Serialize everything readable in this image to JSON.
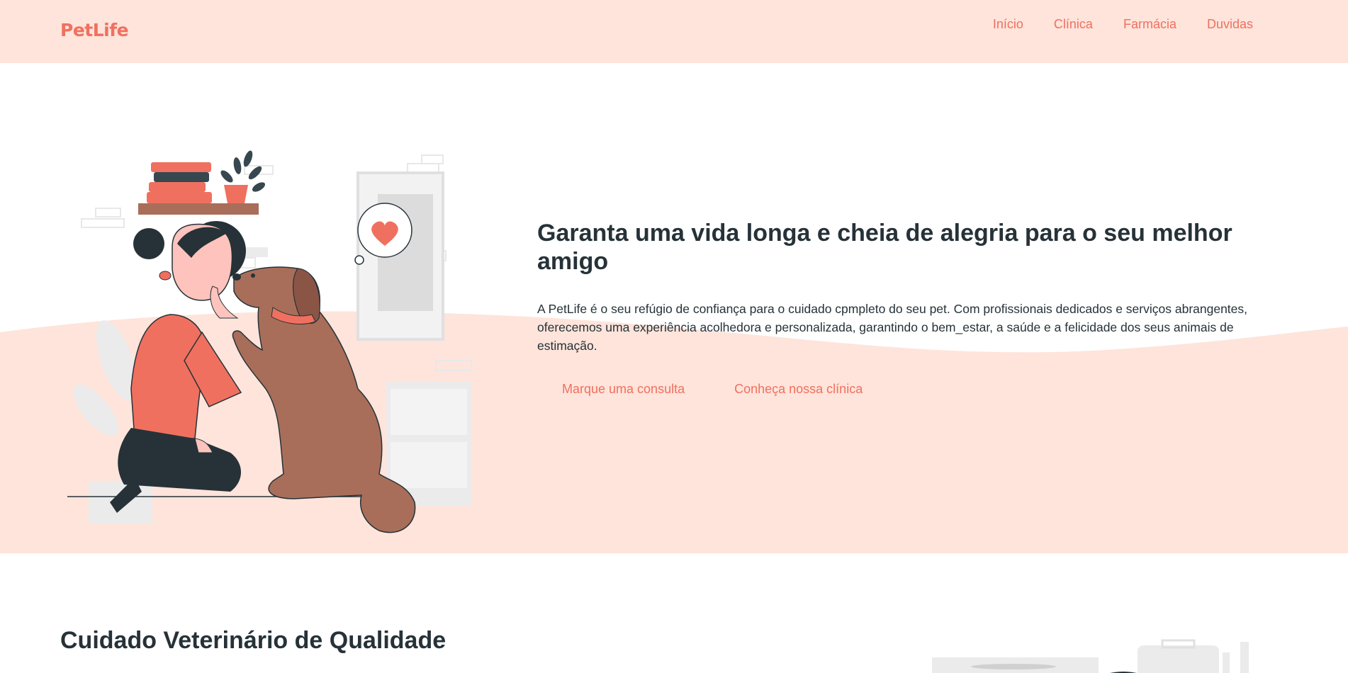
{
  "header": {
    "logo": "PetLife",
    "nav": [
      {
        "label": "Início"
      },
      {
        "label": "Clínica"
      },
      {
        "label": "Farmácia"
      },
      {
        "label": "Duvidas"
      }
    ]
  },
  "hero": {
    "title": "Garanta uma vida longa e cheia de alegria para o seu melhor amigo",
    "description": "A PetLife é o seu refúgio de confiança para o cuidado cpmpleto do seu pet. Com profissionais dedicados e serviços abrangentes, oferecemos uma experiência acolhedora e personalizada, garantindo o bem_estar, a saúde e a felicidade dos seus animais de estimação.",
    "primary_action": "Marque uma consulta",
    "secondary_action": "Conheça nossa clínica"
  },
  "section2": {
    "title": "Cuidado Veterinário de Qualidade"
  },
  "colors": {
    "accent": "#f0705f",
    "header_bg": "#fee4db",
    "hero_wave": "#fee4db",
    "text": "#263238",
    "dog": "#a86e5a"
  },
  "icons": [
    "heart-icon"
  ]
}
